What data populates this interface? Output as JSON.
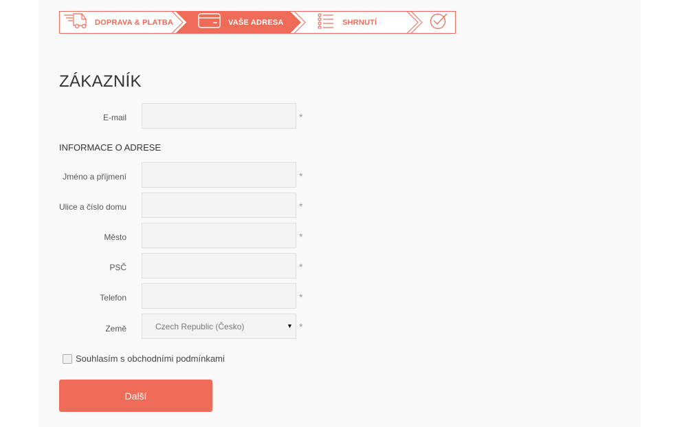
{
  "steps": [
    {
      "label": "DOPRAVA & PLATBA",
      "icon": "delivery-truck-icon",
      "state": "done"
    },
    {
      "label": "VAŠE ADRESA",
      "icon": "credit-card-icon",
      "state": "active"
    },
    {
      "label": "SHRNUTÍ",
      "icon": "list-icon",
      "state": "pending"
    },
    {
      "label": "",
      "icon": "checkmark-icon",
      "state": "pending"
    }
  ],
  "colors": {
    "accent": "#ee6b58",
    "panel": "#f9f9f9",
    "field_bg": "#f4f4f4"
  },
  "customer": {
    "title": "ZÁKAZNÍK",
    "email": {
      "label": "E-mail",
      "value": "",
      "required_mark": "*"
    }
  },
  "address": {
    "title": "INFORMACE O ADRESE",
    "name": {
      "label": "Jméno a příjmení",
      "value": "",
      "required_mark": "*"
    },
    "street": {
      "label": "Ulice a číslo domu",
      "value": "",
      "required_mark": "*"
    },
    "city": {
      "label": "Město",
      "value": "",
      "required_mark": "*"
    },
    "zip": {
      "label": "PSČ",
      "value": "",
      "required_mark": "*"
    },
    "phone": {
      "label": "Telefon",
      "value": "",
      "required_mark": "*"
    },
    "country": {
      "label": "Země",
      "selected": "Czech Republic (Česko)",
      "required_mark": "*"
    }
  },
  "consent": {
    "label": "Souhlasím s obchodními podmínkami",
    "checked": false
  },
  "next_button": {
    "label": "Další"
  }
}
